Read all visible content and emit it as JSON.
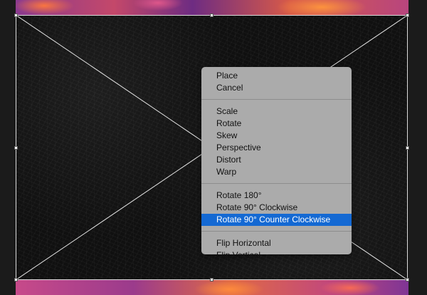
{
  "menu": {
    "groups": [
      {
        "items": [
          {
            "label": "Place"
          },
          {
            "label": "Cancel"
          }
        ]
      },
      {
        "items": [
          {
            "label": "Scale"
          },
          {
            "label": "Rotate"
          },
          {
            "label": "Skew"
          },
          {
            "label": "Perspective"
          },
          {
            "label": "Distort"
          },
          {
            "label": "Warp"
          }
        ]
      },
      {
        "items": [
          {
            "label": "Rotate 180°"
          },
          {
            "label": "Rotate 90° Clockwise"
          },
          {
            "label": "Rotate 90° Counter Clockwise",
            "selected": true
          }
        ]
      },
      {
        "items": [
          {
            "label": "Flip Horizontal"
          },
          {
            "label": "Flip Vertical"
          }
        ]
      }
    ]
  },
  "colors": {
    "menu_background": "#ababab",
    "highlight": "#1469d3",
    "transform_line": "#dcdcdc"
  }
}
